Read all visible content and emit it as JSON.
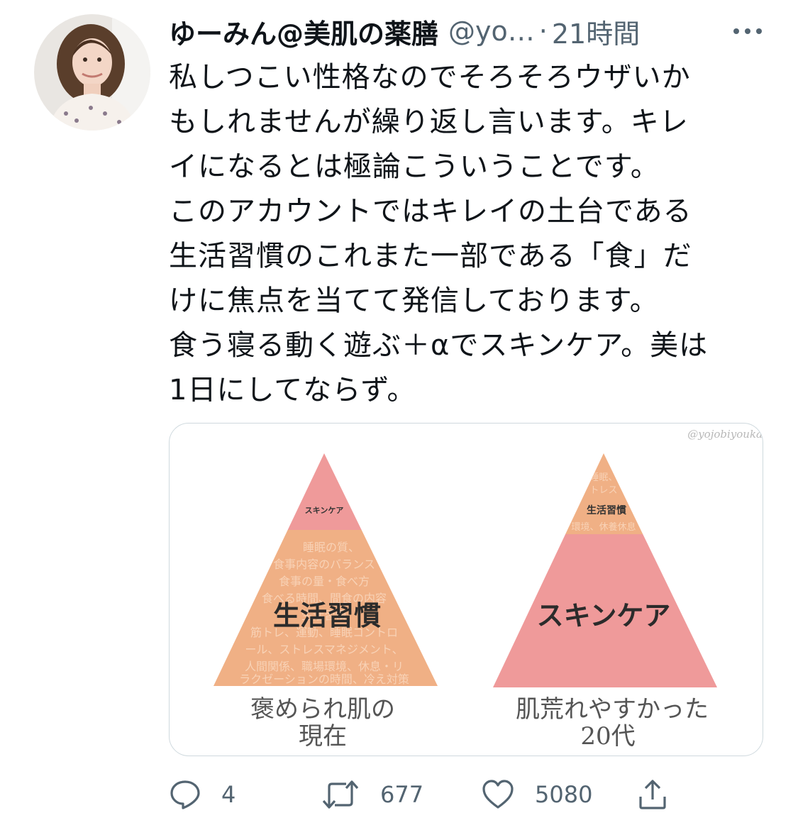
{
  "tweet": {
    "author_name": "ゆーみん@美肌の薬膳",
    "handle": "@yo…",
    "separator": "·",
    "time": "21時間",
    "lines": [
      "私しつこい性格なのでそろそろウザいか",
      "もしれませんが繰り返し言います。キレ",
      "イになるとは極論こういうことです。",
      "このアカウントではキレイの土台である",
      "生活習慣のこれまた一部である「食」だ",
      "けに焦点を当てて発信しております。",
      "食う寝る動く遊ぶ＋αでスキンケア。美は",
      "1日にしてならず。"
    ]
  },
  "image": {
    "watermark": "@yojobiyouka",
    "left_pyramid": {
      "top_label": "スキンケア",
      "main_label": "生活習慣",
      "background_lines": [
        "睡眠の質、",
        "食事内容のバランス",
        "食事の量・食べ方",
        "食べる時間、間食の内容",
        "生活習慣",
        "筋トレ、運動、睡眠コントロ",
        "ール、ストレスマネジメント、",
        "人間関係、職場環境、休息・リ",
        "ラクゼーションの時間、冷え対策"
      ],
      "caption_line1": "褒められ肌の",
      "caption_line2": "現在",
      "top_color": "#ef9a9a",
      "base_color": "#f0b085"
    },
    "right_pyramid": {
      "top_label": "生活習慣",
      "main_label": "スキンケア",
      "background_lines": [
        "睡眠、",
        "トレス",
        "環境、休養休息"
      ],
      "caption_line1": "肌荒れやすかった",
      "caption_line2": "20代",
      "top_color": "#f0b085",
      "base_color": "#ef9a9a"
    }
  },
  "actions": {
    "reply_count": "4",
    "retweet_count": "677",
    "like_count": "5080"
  }
}
